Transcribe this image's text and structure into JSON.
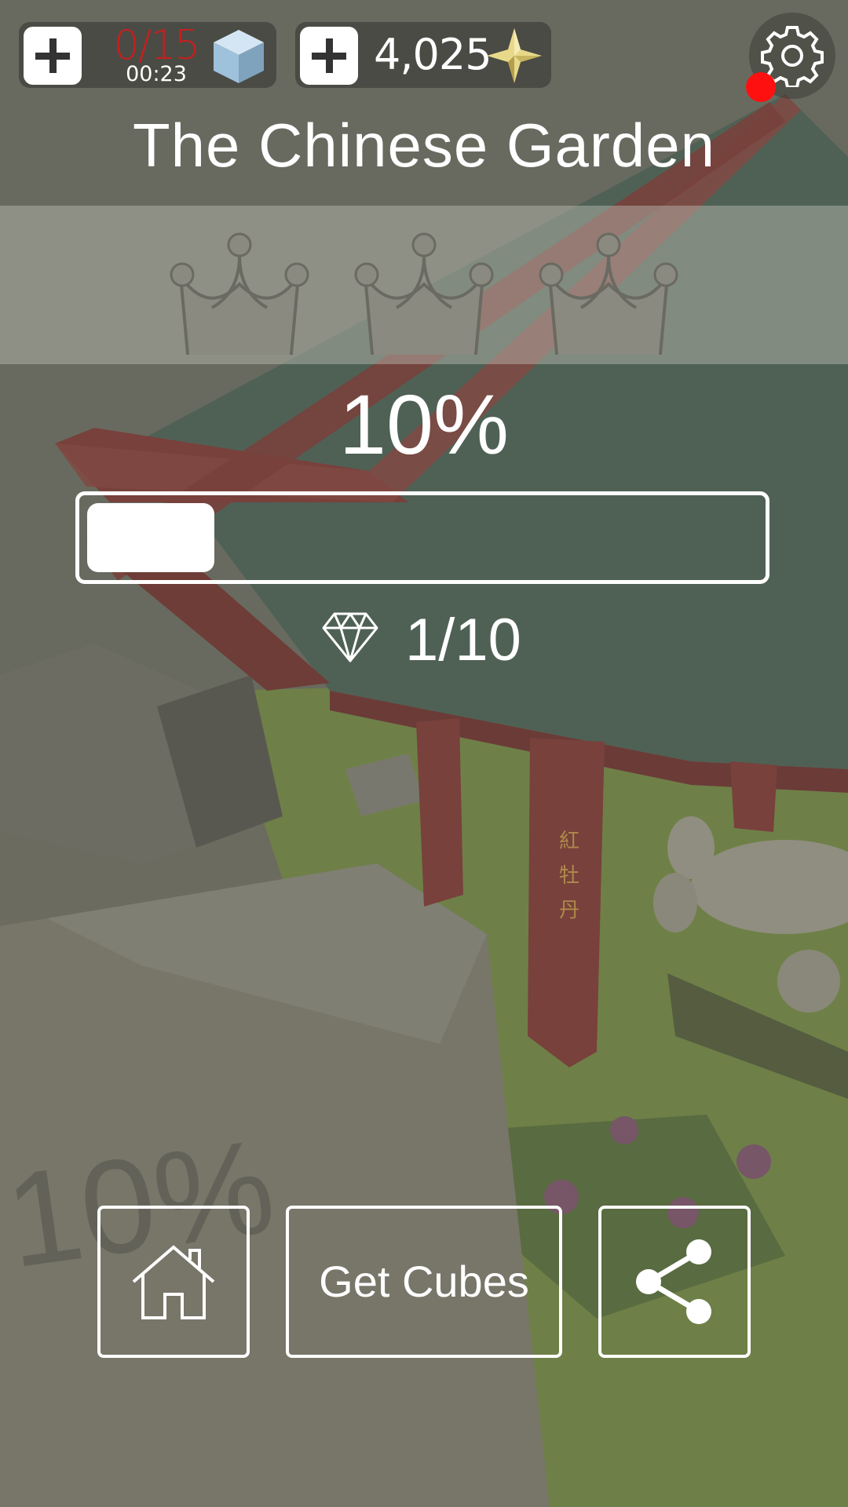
{
  "hud": {
    "cube_count": "0/15",
    "cube_timer": "00:23",
    "cube_count_color": "#c42020",
    "stars_amount": "4,025",
    "icons": [
      "plus-icon",
      "cube-icon",
      "star-icon",
      "gear-icon"
    ],
    "settings_has_notification": true,
    "notification_color": "#ff1010"
  },
  "level": {
    "title": "The Chinese Garden",
    "crowns_earned": 0,
    "crowns_total": 3,
    "percent_label": "10%",
    "progress_fraction": 0.1,
    "gems": "1/10"
  },
  "sign_text": "紅牡丹",
  "ground_text": "10%",
  "buttons": {
    "home_icon": "home-icon",
    "get_cubes_label": "Get Cubes",
    "share_icon": "share-icon"
  },
  "colors": {
    "accent_white": "#ffffff",
    "pagoda_red": "#8e3a36",
    "grass": "#6f8a3c"
  }
}
